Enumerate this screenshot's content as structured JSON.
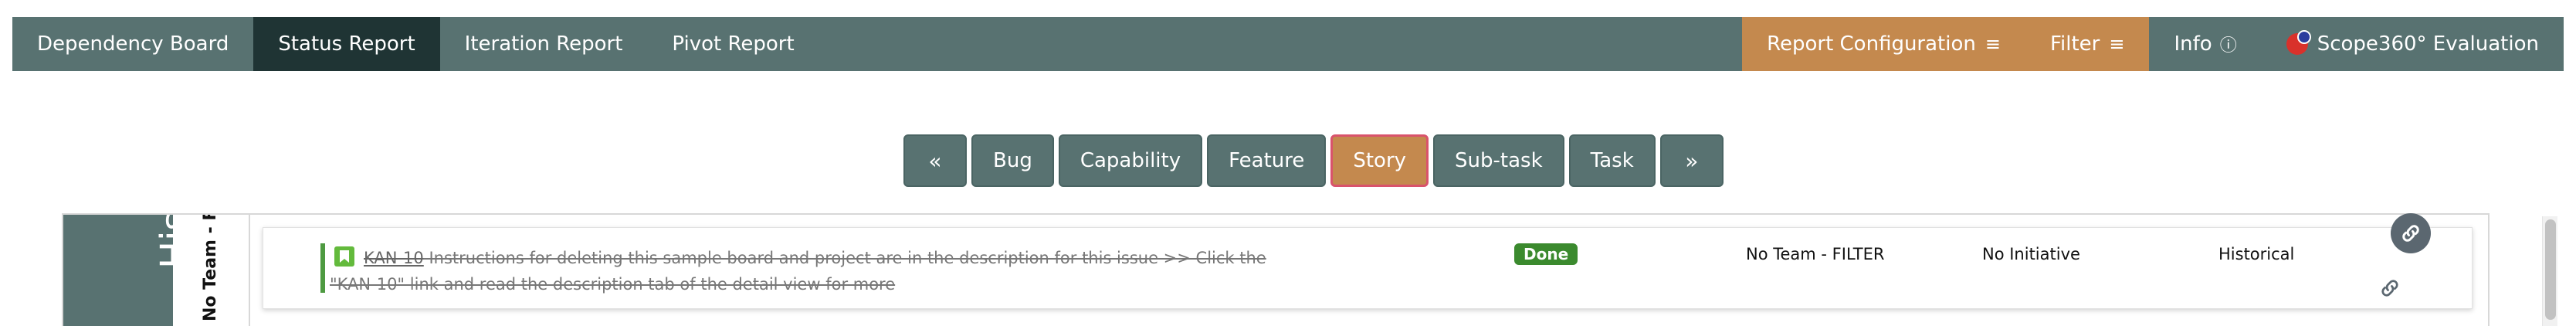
{
  "navbar": {
    "left_items": [
      {
        "label": "Dependency Board",
        "active": false
      },
      {
        "label": "Status Report",
        "active": true
      },
      {
        "label": "Iteration Report",
        "active": false
      },
      {
        "label": "Pivot Report",
        "active": false
      }
    ],
    "report_configuration": "Report Configuration",
    "filter": "Filter",
    "menu_glyph": "≡",
    "info": "Info",
    "info_glyph": "ⓘ",
    "product_name": "Scope360° Evaluation"
  },
  "type_filter": {
    "prev": "«",
    "next": "»",
    "types": [
      "Bug",
      "Capability",
      "Feature",
      "Story",
      "Sub-task",
      "Task"
    ],
    "selected": "Story"
  },
  "board": {
    "swimlane_label": "Historical",
    "team_label": "No Team - FILTER",
    "cards": [
      {
        "key": "KAN-10",
        "summary": " Instructions for deleting this sample board and project are in the description for this issue >> Click the \"KAN-10\" link and read the description tab of the detail view for more",
        "status": "Done",
        "team": "No Team - FILTER",
        "initiative": "No Initiative",
        "sprint": "Historical"
      }
    ]
  },
  "colors": {
    "nav_bg": "#587271",
    "nav_active": "#1f3434",
    "accent_orange": "#c4894e",
    "selected_border": "#d9536c",
    "status_done": "#3b8a2e",
    "story_icon": "#63ba3c"
  }
}
